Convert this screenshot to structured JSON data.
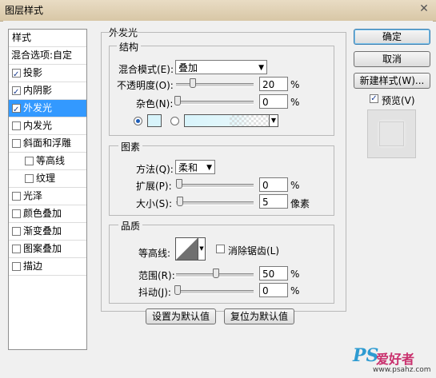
{
  "window": {
    "title": "图层样式",
    "close_glyph": "✕"
  },
  "styles_panel": {
    "header": "样式",
    "blend_options": "混合选项:自定",
    "items": [
      {
        "label": "投影",
        "checked": true
      },
      {
        "label": "内阴影",
        "checked": true
      },
      {
        "label": "外发光",
        "checked": true,
        "selected": true
      },
      {
        "label": "内发光",
        "checked": false
      },
      {
        "label": "斜面和浮雕",
        "checked": false
      },
      {
        "label": "等高线",
        "checked": false,
        "sub": true
      },
      {
        "label": "纹理",
        "checked": false,
        "sub": true
      },
      {
        "label": "光泽",
        "checked": false
      },
      {
        "label": "颜色叠加",
        "checked": false
      },
      {
        "label": "渐变叠加",
        "checked": false
      },
      {
        "label": "图案叠加",
        "checked": false
      },
      {
        "label": "描边",
        "checked": false
      }
    ]
  },
  "outer_glow": {
    "title": "外发光",
    "structure": {
      "title": "结构",
      "blend_mode_label": "混合模式(E):",
      "blend_mode_value": "叠加",
      "opacity_label": "不透明度(O):",
      "opacity_value": "20",
      "opacity_pct": 20,
      "noise_label": "杂色(N):",
      "noise_value": "0",
      "noise_pct": 0,
      "percent": "%",
      "swatch_color": "#d8f4fb"
    },
    "elements": {
      "title": "图素",
      "technique_label": "方法(Q):",
      "technique_value": "柔和",
      "spread_label": "扩展(P):",
      "spread_value": "0",
      "size_label": "大小(S):",
      "size_value": "5",
      "size_unit": "像素",
      "percent": "%"
    },
    "quality": {
      "title": "品质",
      "contour_label": "等高线:",
      "anti_alias_label": "消除锯齿(L)",
      "range_label": "范围(R):",
      "range_value": "50",
      "range_pct": 50,
      "jitter_label": "抖动(J):",
      "jitter_value": "0",
      "jitter_pct": 0,
      "percent": "%"
    },
    "make_default": "设置为默认值",
    "reset_default": "复位为默认值"
  },
  "buttons": {
    "ok": "确定",
    "cancel": "取消",
    "new_style": "新建样式(W)...",
    "preview": "预览(V)"
  },
  "watermark": {
    "ps": "PS",
    "cn": "爱好者",
    "url": "www.psahz.com"
  }
}
